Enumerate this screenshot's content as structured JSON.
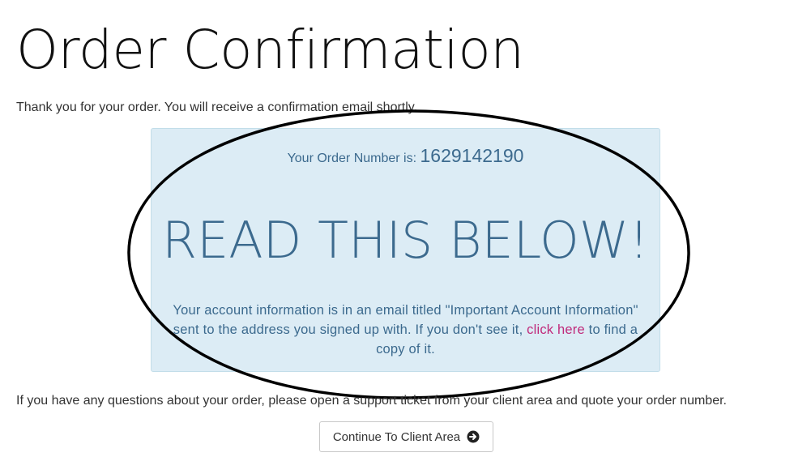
{
  "header": {
    "title": "Order Confirmation"
  },
  "messages": {
    "thank_you": "Thank you for your order. You will receive a confirmation email shortly.",
    "questions": "If you have any questions about your order, please open a support ticket from your client area and quote your order number."
  },
  "order_box": {
    "order_number_label": "Your Order Number is:",
    "order_number": "1629142190",
    "heading": "READ THIS BELOW!",
    "info_before_link": "Your account information is in an email titled \"Important Account Information\" sent to the address you signed up with. If you don't see it,",
    "link_text": "click here",
    "info_after_link": "to find a copy of it."
  },
  "actions": {
    "continue_label": "Continue To Client Area",
    "continue_icon": "arrow-circle-right-icon"
  },
  "colors": {
    "box_background": "#dcecf5",
    "box_text": "#3c6a8e",
    "link": "#c0297a"
  }
}
